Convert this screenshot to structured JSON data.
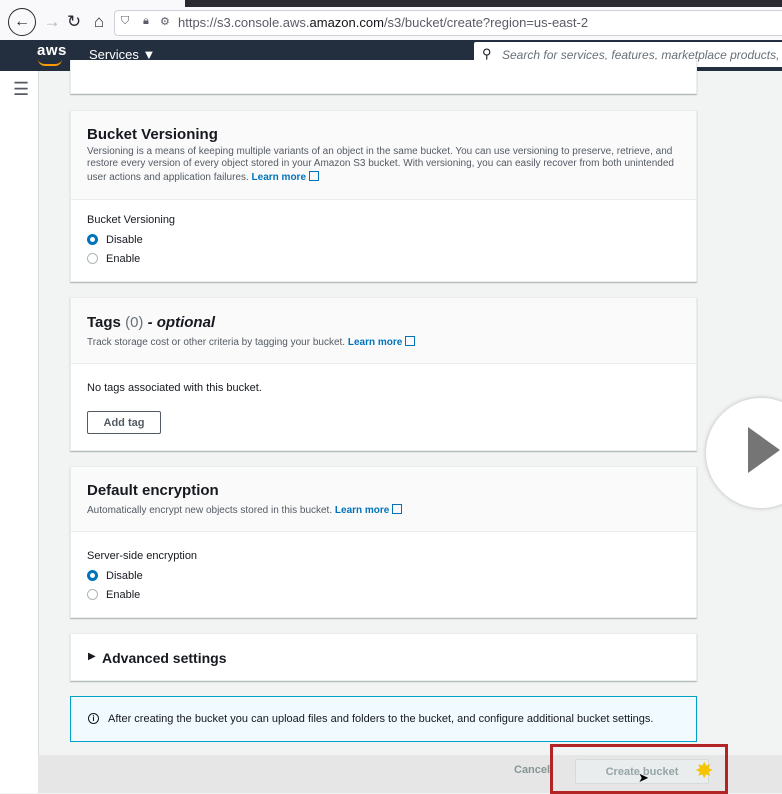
{
  "browser": {
    "url_prefix": "https://s3.console.aws.",
    "url_host": "amazon.com",
    "url_path": "/s3/bucket/create?region=us-east-2"
  },
  "aws_header": {
    "logo": "aws",
    "services_label": "Services",
    "search_placeholder": "Search for services, features, marketplace products, and d"
  },
  "versioning": {
    "title": "Bucket Versioning",
    "description": "Versioning is a means of keeping multiple variants of an object in the same bucket. You can use versioning to preserve, retrieve, and restore every version of every object stored in your Amazon S3 bucket. With versioning, you can easily recover from both unintended user actions and application failures.",
    "learn_more": "Learn more",
    "field_label": "Bucket Versioning",
    "options": [
      "Disable",
      "Enable"
    ],
    "selected": "Disable"
  },
  "tags": {
    "title": "Tags",
    "count": "(0)",
    "optional": "- optional",
    "description": "Track storage cost or other criteria by tagging your bucket.",
    "learn_more": "Learn more",
    "empty_text": "No tags associated with this bucket.",
    "add_button": "Add tag"
  },
  "encryption": {
    "title": "Default encryption",
    "description": "Automatically encrypt new objects stored in this bucket.",
    "learn_more": "Learn more",
    "field_label": "Server-side encryption",
    "options": [
      "Disable",
      "Enable"
    ],
    "selected": "Disable"
  },
  "advanced": {
    "title": "Advanced settings"
  },
  "info": {
    "text": "After creating the bucket you can upload files and folders to the bucket, and configure additional bucket settings."
  },
  "footer": {
    "cancel_label": "Cancel",
    "create_label": "Create bucket"
  },
  "colors": {
    "accent": "#0073bb",
    "header_bg": "#232f3e",
    "highlight": "#b32424"
  }
}
